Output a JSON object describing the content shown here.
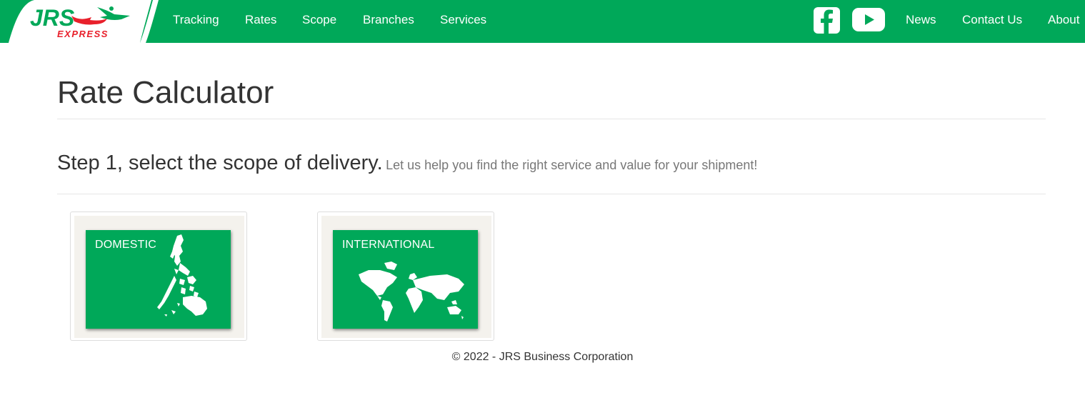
{
  "brand": {
    "logo_text": "JRS",
    "logo_subtext": "EXPRESS",
    "primary_color": "#00a859",
    "accent_color": "#e8202b"
  },
  "nav": {
    "tracking": "Tracking",
    "rates": "Rates",
    "scope": "Scope",
    "branches": "Branches",
    "services": "Services",
    "news": "News",
    "contact": "Contact Us",
    "about": "About"
  },
  "social": {
    "facebook_icon": "facebook-icon",
    "youtube_icon": "youtube-icon"
  },
  "page": {
    "title": "Rate Calculator",
    "step_heading": "Step 1, select the scope of delivery.",
    "step_subtext": "Let us help you find the right service and value for your shipment!"
  },
  "scopes": [
    {
      "label": "DOMESTIC",
      "icon": "philippines-map-icon"
    },
    {
      "label": "INTERNATIONAL",
      "icon": "world-map-icon"
    }
  ],
  "footer": {
    "copyright": "© 2022 - JRS Business Corporation"
  }
}
